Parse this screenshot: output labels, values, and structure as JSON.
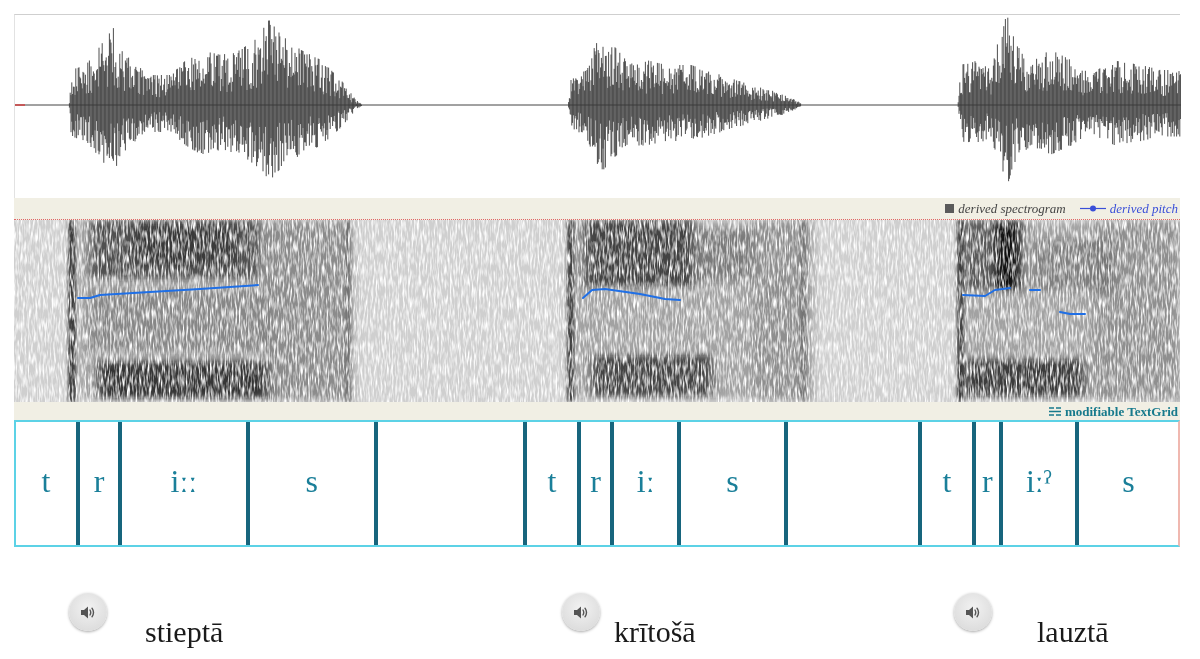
{
  "spectrogram_panel": {
    "legend": [
      {
        "kind": "spectrogram",
        "label": "derived spectrogram"
      },
      {
        "kind": "pitch",
        "label": "derived pitch"
      }
    ]
  },
  "textgrid": {
    "title": "modifiable TextGrid",
    "intervals": [
      {
        "kind": "segment",
        "label": "t"
      },
      {
        "kind": "segment",
        "label": "r"
      },
      {
        "kind": "segment",
        "label": "iːː"
      },
      {
        "kind": "segment",
        "label": "s"
      },
      {
        "kind": "pause"
      },
      {
        "kind": "segment",
        "label": "t"
      },
      {
        "kind": "segment",
        "label": "r"
      },
      {
        "kind": "segment",
        "label": "iː"
      },
      {
        "kind": "segment",
        "label": "s"
      },
      {
        "kind": "pause"
      },
      {
        "kind": "segment",
        "label": "t"
      },
      {
        "kind": "segment",
        "label": "r"
      },
      {
        "kind": "segment",
        "label": "iːˀ"
      },
      {
        "kind": "segment",
        "label": "s"
      }
    ]
  },
  "words": [
    {
      "text": "stieptā"
    },
    {
      "text": "krītošā"
    },
    {
      "text": "lauztā"
    }
  ]
}
